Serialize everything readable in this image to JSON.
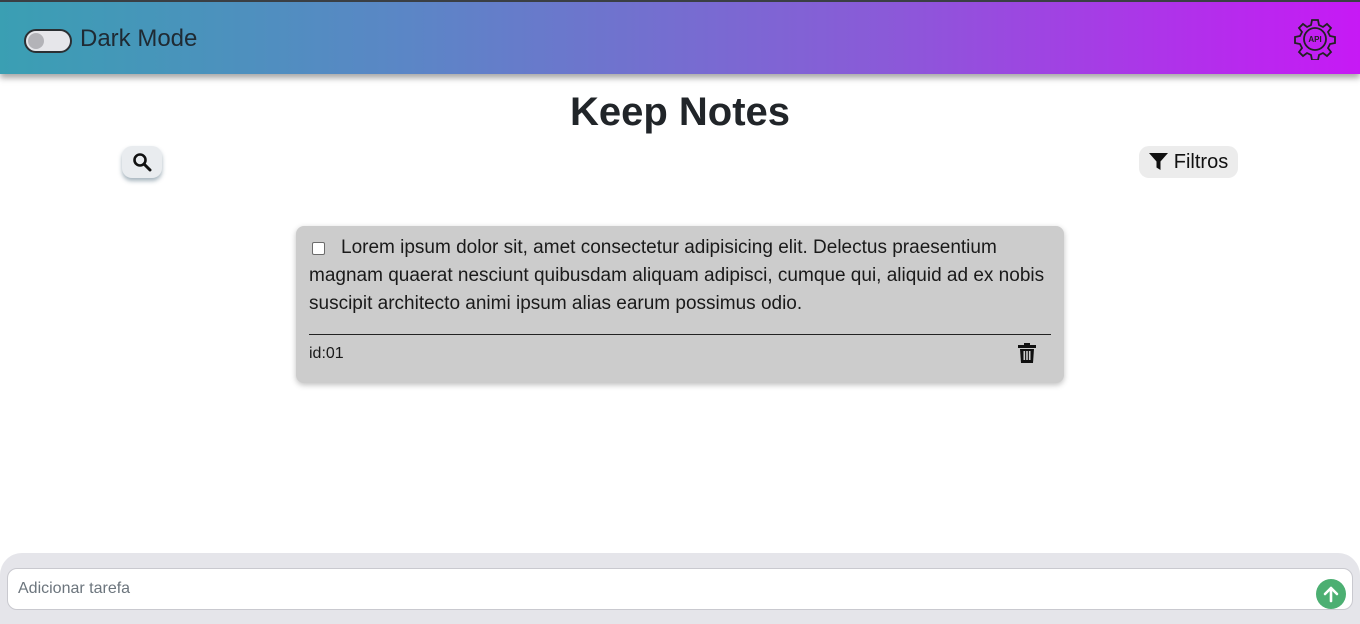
{
  "header": {
    "dark_mode_label": "Dark Mode",
    "api_badge": "API",
    "gradient_colors": [
      "#3a9fb3",
      "#5b86c6",
      "#8a5ad8",
      "#c719f5"
    ]
  },
  "page": {
    "title": "Keep Notes"
  },
  "toolbar": {
    "search_icon": "search-icon",
    "filter_icon": "filter-icon",
    "filter_label": "Filtros"
  },
  "notes": [
    {
      "checked": false,
      "text": "Lorem ipsum dolor sit, amet consectetur adipisicing elit. Delectus praesentium magnam quaerat nesciunt quibusdam aliquam adipisci, cumque qui, aliquid ad ex nobis suscipit architecto animi ipsum alias earum possimus odio.",
      "id_label": "id:01",
      "delete_icon": "trash-icon"
    }
  ],
  "footer": {
    "input_placeholder": "Adicionar tarefa",
    "input_value": "",
    "send_icon": "arrow-up-icon",
    "send_color": "#4caf72"
  }
}
